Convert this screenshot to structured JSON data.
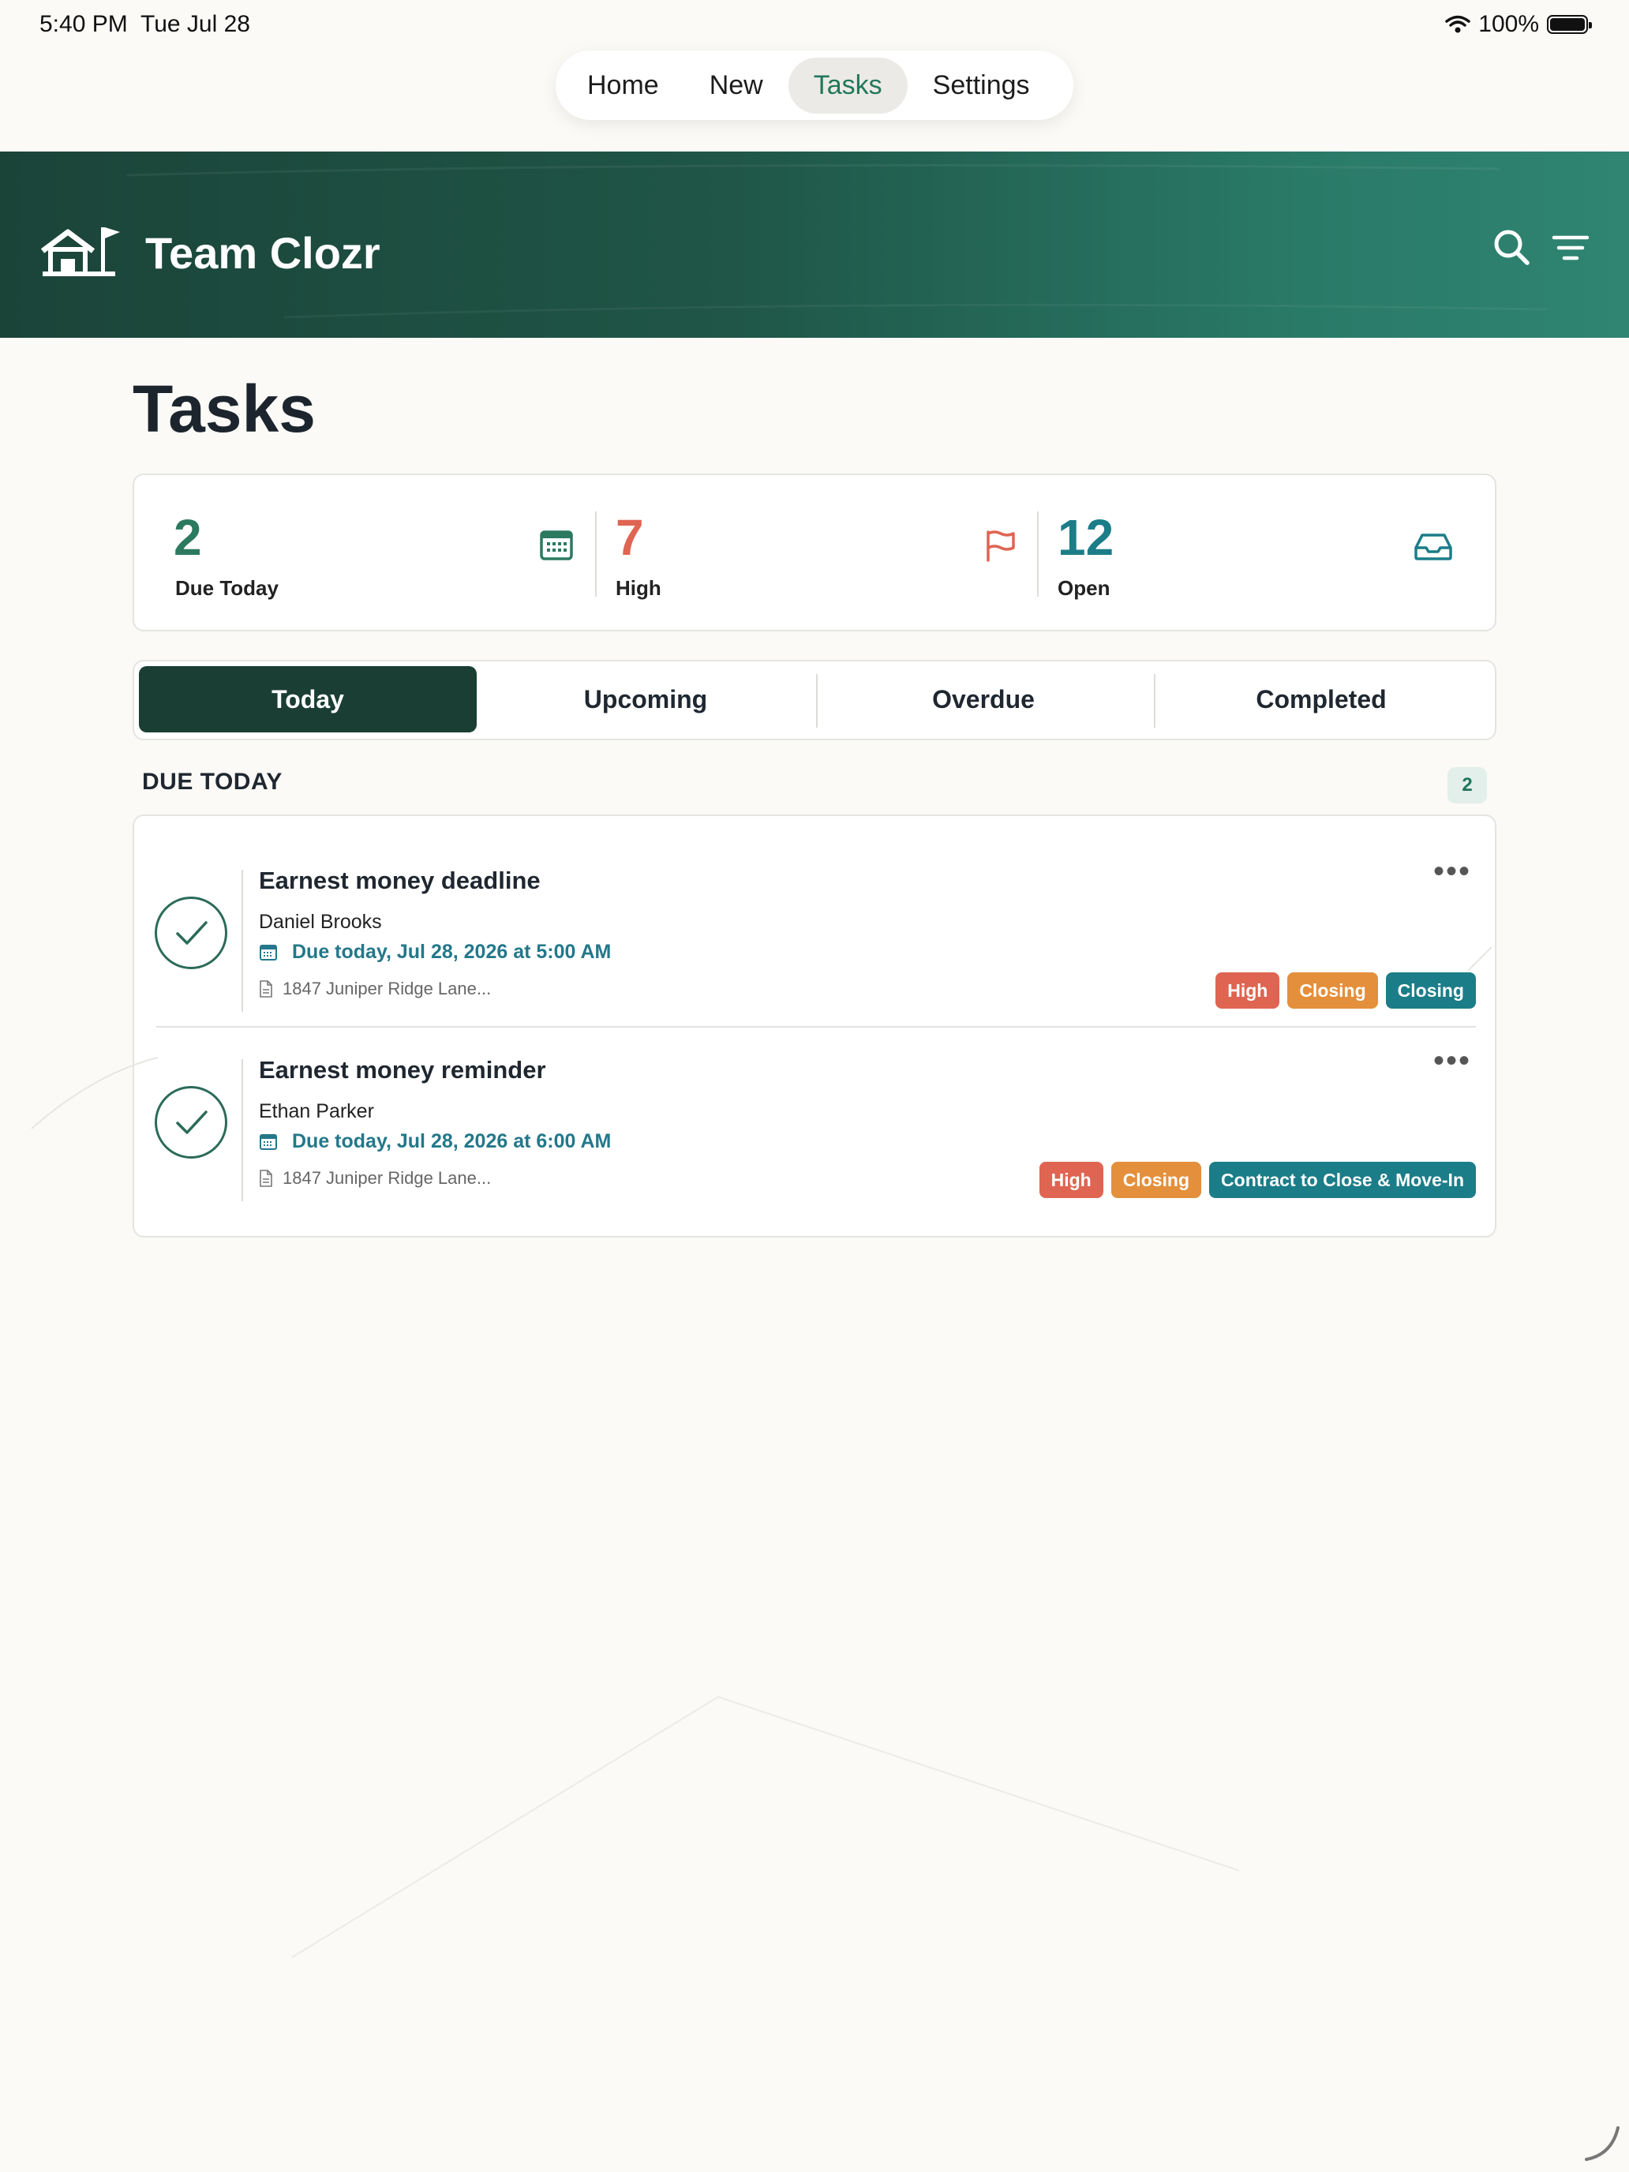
{
  "status_bar": {
    "time": "5:40 PM",
    "date": "Tue Jul 28",
    "battery": "100%"
  },
  "top_nav": {
    "items": [
      "Home",
      "New",
      "Tasks",
      "Settings"
    ],
    "active": "Tasks"
  },
  "header": {
    "brand": "Team Clozr"
  },
  "page": {
    "title": "Tasks"
  },
  "stats": [
    {
      "value": "2",
      "label": "Due Today",
      "color": "#2b7a60",
      "icon": "calendar-icon"
    },
    {
      "value": "7",
      "label": "High",
      "color": "#df6552",
      "icon": "flag-icon"
    },
    {
      "value": "12",
      "label": "Open",
      "color": "#1b7d88",
      "icon": "inbox-icon"
    }
  ],
  "tabs": [
    "Today",
    "Upcoming",
    "Overdue",
    "Completed"
  ],
  "section": {
    "title": "DUE TODAY",
    "count": "2"
  },
  "tasks": [
    {
      "title": "Earnest money deadline",
      "person": "Daniel Brooks",
      "due": "Due today, Jul 28, 2026 at 5:00 AM",
      "address": "1847 Juniper Ridge Lane...",
      "tags": [
        "High",
        "Closing",
        "Closing"
      ]
    },
    {
      "title": "Earnest money reminder",
      "person": "Ethan Parker",
      "due": "Due today, Jul 28, 2026 at 6:00 AM",
      "address": "1847 Juniper Ridge Lane...",
      "tags": [
        "High",
        "Closing",
        "Contract to Close & Move-In"
      ]
    }
  ],
  "more_symbol": "•••"
}
